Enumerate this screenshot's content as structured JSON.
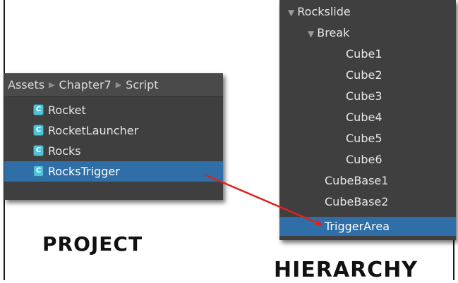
{
  "project": {
    "breadcrumb": [
      "Assets",
      "Chapter7",
      "Script"
    ],
    "items": [
      {
        "label": "Rocket",
        "selected": false
      },
      {
        "label": "RocketLauncher",
        "selected": false
      },
      {
        "label": "Rocks",
        "selected": false
      },
      {
        "label": "RocksTrigger",
        "selected": true
      }
    ],
    "caption": "PROJECT"
  },
  "hierarchy": {
    "items": [
      {
        "label": "Rockslide",
        "expanded": true
      },
      {
        "label": "Break",
        "expanded": true
      },
      {
        "label": "Cube1"
      },
      {
        "label": "Cube2"
      },
      {
        "label": "Cube3"
      },
      {
        "label": "Cube4"
      },
      {
        "label": "Cube5"
      },
      {
        "label": "Cube6"
      },
      {
        "label": "CubeBase1"
      },
      {
        "label": "CubeBase2"
      },
      {
        "label": "TriggerArea",
        "selected": true
      }
    ],
    "caption": "HIERARCHY"
  },
  "colors": {
    "panel_bg": "#3f3f3f",
    "selection": "#2f6ea6",
    "script_icon": "#4fc3d9",
    "arrow": "#e0231c"
  },
  "icons": {
    "script_icon": "csharp-script-icon",
    "expand_icon": "triangle-down-icon",
    "breadcrumb_separator": "triangle-right-icon"
  }
}
